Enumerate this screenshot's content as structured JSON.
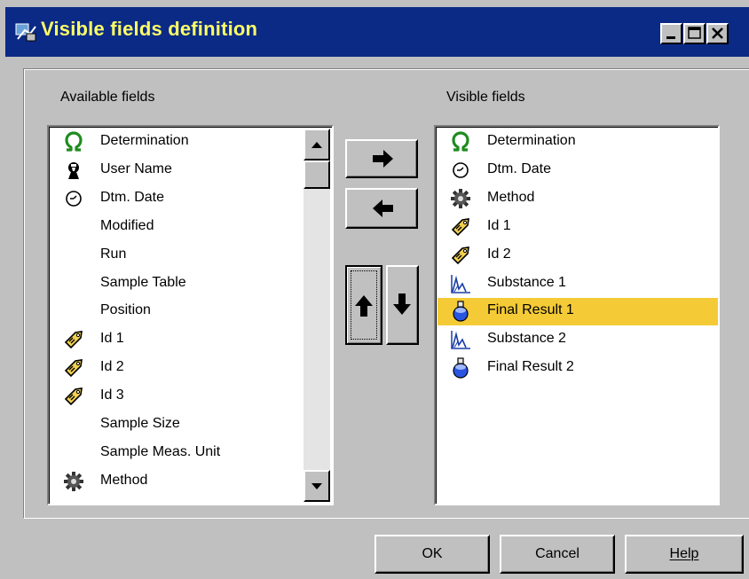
{
  "window": {
    "title": "Visible fields definition",
    "minimize_label": "minimize",
    "maximize_label": "maximize",
    "close_label": "close"
  },
  "available": {
    "caption": "Available fields",
    "items": [
      {
        "label": "Determination",
        "icon": "omega-icon"
      },
      {
        "label": "User Name",
        "icon": "user-icon"
      },
      {
        "label": "Dtm. Date",
        "icon": "clock-icon"
      },
      {
        "label": "Modified",
        "icon": ""
      },
      {
        "label": "Run",
        "icon": ""
      },
      {
        "label": "Sample Table",
        "icon": ""
      },
      {
        "label": "Position",
        "icon": ""
      },
      {
        "label": "Id 1",
        "icon": "tag-icon"
      },
      {
        "label": "Id 2",
        "icon": "tag-icon"
      },
      {
        "label": "Id 3",
        "icon": "tag-icon"
      },
      {
        "label": "Sample Size",
        "icon": ""
      },
      {
        "label": "Sample Meas. Unit",
        "icon": ""
      },
      {
        "label": "Method",
        "icon": "gear-icon"
      }
    ]
  },
  "visible": {
    "caption": "Visible fields",
    "selected_index": 6,
    "items": [
      {
        "label": "Determination",
        "icon": "omega-icon"
      },
      {
        "label": "Dtm. Date",
        "icon": "clock-icon"
      },
      {
        "label": "Method",
        "icon": "gear-icon"
      },
      {
        "label": "Id 1",
        "icon": "tag-icon"
      },
      {
        "label": "Id 2",
        "icon": "tag-icon"
      },
      {
        "label": "Substance 1",
        "icon": "peak-chart-icon"
      },
      {
        "label": "Final Result 1",
        "icon": "flask-icon"
      },
      {
        "label": "Substance 2",
        "icon": "peak-chart-icon"
      },
      {
        "label": "Final Result 2",
        "icon": "flask-icon"
      }
    ]
  },
  "buttons": {
    "ok": "OK",
    "cancel": "Cancel",
    "help": "Help"
  },
  "colors": {
    "titlebar": "#0a2a86",
    "title_text": "#ffff66",
    "selection": "#f4cb36",
    "face": "#c0c0c0"
  }
}
